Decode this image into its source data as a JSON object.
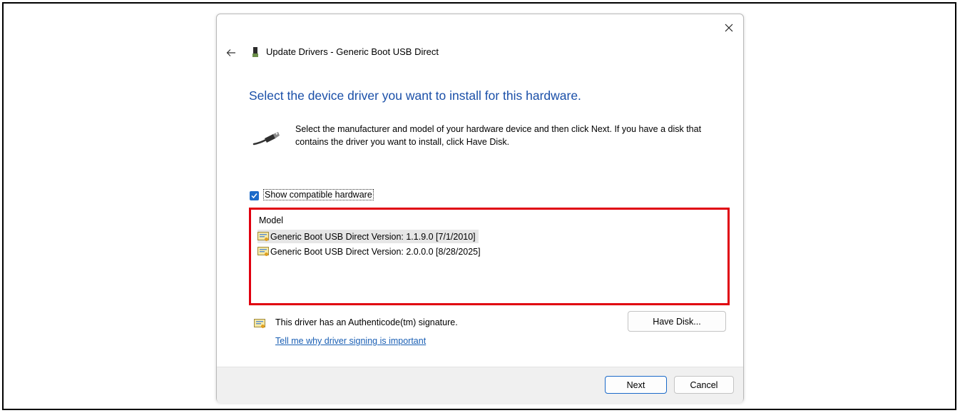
{
  "window": {
    "title": "Update Drivers - Generic Boot USB Direct"
  },
  "heading": "Select the device driver you want to install for this hardware.",
  "instructions": "Select the manufacturer and model of your hardware device and then click Next. If you have a disk that contains the driver you want to install, click Have Disk.",
  "show_compatible": {
    "checked": true,
    "label": "Show compatible hardware"
  },
  "model_list": {
    "header": "Model",
    "items": [
      {
        "label": "Generic Boot USB Direct Version: 1.1.9.0 [7/1/2010]",
        "selected": true,
        "icon": "certificate-icon"
      },
      {
        "label": "Generic Boot USB Direct Version: 2.0.0.0 [8/28/2025]",
        "selected": false,
        "icon": "certificate-icon"
      }
    ]
  },
  "signature": {
    "text": "This driver has an Authenticode(tm) signature.",
    "link": "Tell me why driver signing is important",
    "icon": "certificate-icon"
  },
  "buttons": {
    "have_disk": "Have Disk...",
    "next": "Next",
    "cancel": "Cancel"
  },
  "colors": {
    "heading": "#1a4fa8",
    "highlight_box": "#e0000f",
    "accent": "#1b6ac9",
    "link": "#1a5fb4"
  }
}
